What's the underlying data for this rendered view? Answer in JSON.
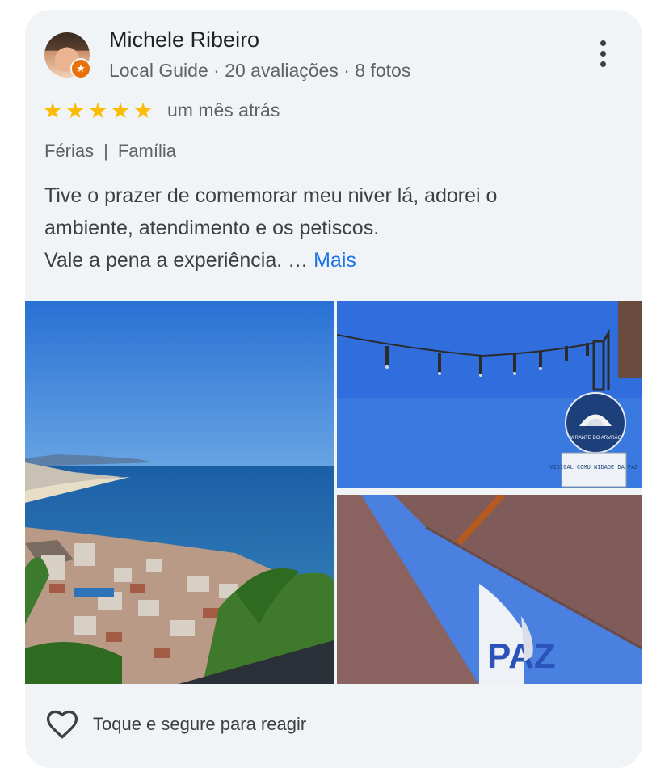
{
  "review": {
    "author": "Michele Ribeiro",
    "author_meta": "Local Guide · 20 avaliações · 8 fotos",
    "rating": 5,
    "stars": [
      "★",
      "★",
      "★",
      "★",
      "★"
    ],
    "time": "um mês atrás",
    "tags": [
      "Férias",
      "Família"
    ],
    "text_lines": [
      "Tive o prazer de comemorar meu niver lá, adorei o",
      "ambiente, atendimento e os petiscos.",
      "Vale a pena a experiência. …"
    ],
    "more_label": "Mais",
    "react_label": "Toque e segure para reagir",
    "sign_text": "MIRANTE DO ARVRÃO",
    "sign_board": "VIDIGAL COMU NIDADE DA PAZ",
    "flag_text": "PAZ"
  },
  "colors": {
    "card_bg": "#f1f4f7",
    "link": "#1a73e8",
    "star": "#fbbc04",
    "badge": "#e8710a"
  },
  "icons": [
    "local-guide-badge-icon",
    "more-vert-icon",
    "star-icon",
    "heart-outline-icon"
  ]
}
